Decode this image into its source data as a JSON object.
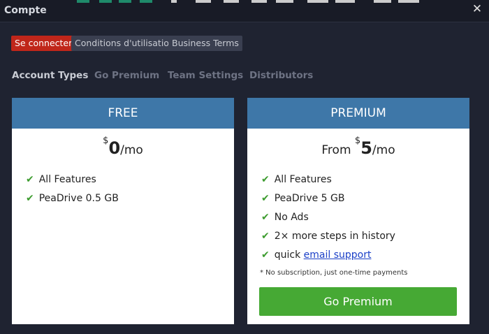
{
  "window": {
    "title": "Compte",
    "close_symbol": "✕"
  },
  "links": {
    "login": "Se connecter",
    "terms": "Conditions d'utilisation",
    "business": "Business Terms"
  },
  "tabs": [
    "Account Types",
    "Go Premium",
    "Team Settings",
    "Distributors"
  ],
  "free": {
    "name": "FREE",
    "currency": "$",
    "amount": "0",
    "per": "/mo",
    "features": [
      "All Features",
      "PeaDrive 0.5 GB"
    ]
  },
  "premium": {
    "name": "PREMIUM",
    "from": "From",
    "currency": "$",
    "amount": "5",
    "per": "/mo",
    "features": [
      "All Features",
      "PeaDrive 5 GB",
      "No Ads",
      "2× more steps in history"
    ],
    "support_prefix": "quick",
    "support_link": "email support",
    "note": "* No subscription, just one-time payments",
    "button": "Go Premium"
  },
  "colors": {
    "header_blue": "#3e77a8",
    "button_green": "#46a934",
    "login_red": "#c0261a",
    "check_green": "#3d9c2f"
  },
  "icons": {
    "check": "✔"
  }
}
